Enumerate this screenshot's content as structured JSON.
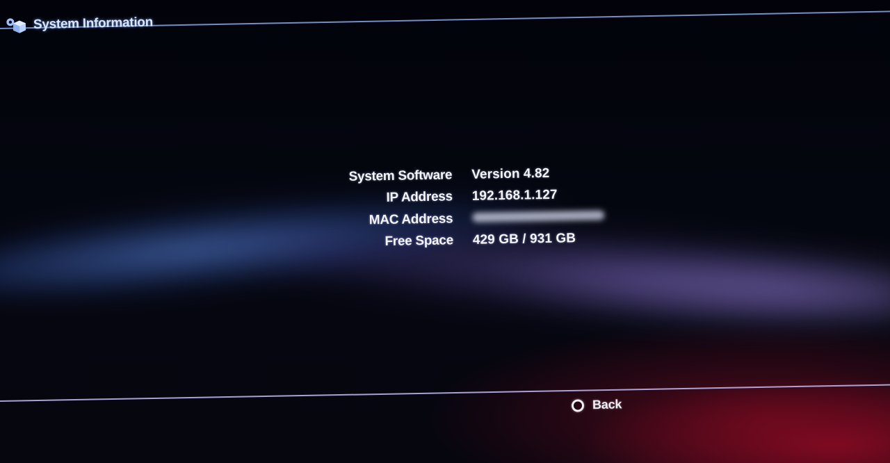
{
  "header": {
    "icon": "settings-cubes-icon",
    "title": "System Information"
  },
  "info": {
    "rows": [
      {
        "label": "System Software",
        "value": "Version 4.82"
      },
      {
        "label": "IP Address",
        "value": "192.168.1.127"
      },
      {
        "label": "MAC Address",
        "value": "",
        "value_redacted": true
      },
      {
        "label": "Free Space",
        "value": "429 GB / 931 GB"
      }
    ]
  },
  "footer": {
    "back_icon": "circle-button-icon",
    "back_label": "Back"
  },
  "colors": {
    "header_text": "#d8e6ff",
    "line_top": "#8aa6e8",
    "line_bottom": "#b9b4ea",
    "wave_blue": "#5078c8",
    "background_red": "#8c0a23"
  }
}
